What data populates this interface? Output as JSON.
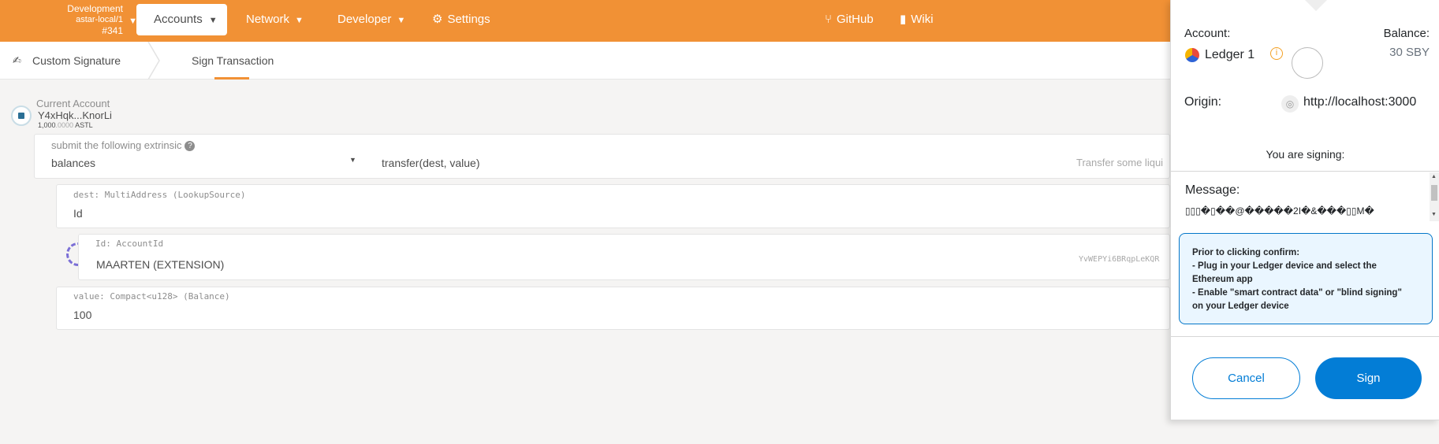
{
  "topbar": {
    "chain_name": "Development",
    "chain_node": "astar-local/1",
    "block": "#341",
    "nav": {
      "accounts": "Accounts",
      "network": "Network",
      "developer": "Developer",
      "settings": "Settings",
      "github": "GitHub",
      "wiki": "Wiki"
    }
  },
  "subnav": {
    "custom_signature": "Custom Signature",
    "sign_transaction": "Sign Transaction"
  },
  "account": {
    "label": "Current Account",
    "address": "Y4xHqk...KnorLi",
    "balance_main": "1,000",
    "balance_dec": ".0000",
    "balance_unit": "ASTL"
  },
  "extrinsic": {
    "label": "submit the following extrinsic",
    "pallet": "balances",
    "call": "transfer(dest, value)",
    "description": "Transfer some liqui"
  },
  "dest": {
    "label": "dest: MultiAddress (LookupSource)",
    "value": "Id"
  },
  "id_field": {
    "label": "Id: AccountId",
    "value": "MAARTEN (EXTENSION)",
    "address": "YvWEPYi6BRqpLeKQR"
  },
  "value_field": {
    "label": "value: Compact<u128> (Balance)",
    "value": "100"
  },
  "popup": {
    "account_label": "Account:",
    "account_name": "Ledger 1",
    "balance_label": "Balance:",
    "balance": "30 SBY",
    "origin_label": "Origin:",
    "origin": "http://localhost:3000",
    "signing_label": "You are signing:",
    "message_label": "Message:",
    "message": "▯▯▯�▯��@�����2I�&���▯▯M�",
    "notice_title": "Prior to clicking confirm:",
    "notice_line1": "- Plug in your Ledger device and select the",
    "notice_line2": "Ethereum app",
    "notice_line3": "- Enable \"smart contract data\" or \"blind signing\"",
    "notice_line4": "on your Ledger device",
    "cancel": "Cancel",
    "sign": "Sign"
  },
  "colors": {
    "brand_orange": "#f19135",
    "metamask_blue": "#037dd6",
    "notice_bg": "#eaf6ff"
  }
}
